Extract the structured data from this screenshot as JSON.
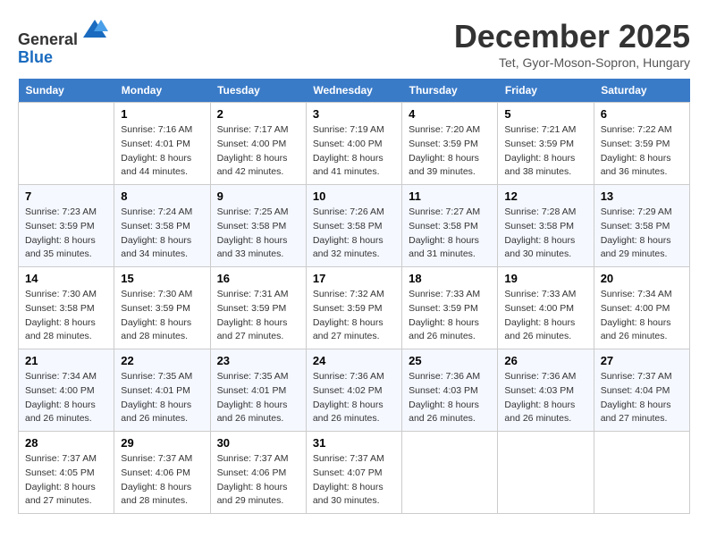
{
  "header": {
    "logo_line1": "General",
    "logo_line2": "Blue",
    "title": "December 2025",
    "location": "Tet, Gyor-Moson-Sopron, Hungary"
  },
  "days_of_week": [
    "Sunday",
    "Monday",
    "Tuesday",
    "Wednesday",
    "Thursday",
    "Friday",
    "Saturday"
  ],
  "weeks": [
    [
      {
        "num": "",
        "info": ""
      },
      {
        "num": "1",
        "info": "Sunrise: 7:16 AM\nSunset: 4:01 PM\nDaylight: 8 hours\nand 44 minutes."
      },
      {
        "num": "2",
        "info": "Sunrise: 7:17 AM\nSunset: 4:00 PM\nDaylight: 8 hours\nand 42 minutes."
      },
      {
        "num": "3",
        "info": "Sunrise: 7:19 AM\nSunset: 4:00 PM\nDaylight: 8 hours\nand 41 minutes."
      },
      {
        "num": "4",
        "info": "Sunrise: 7:20 AM\nSunset: 3:59 PM\nDaylight: 8 hours\nand 39 minutes."
      },
      {
        "num": "5",
        "info": "Sunrise: 7:21 AM\nSunset: 3:59 PM\nDaylight: 8 hours\nand 38 minutes."
      },
      {
        "num": "6",
        "info": "Sunrise: 7:22 AM\nSunset: 3:59 PM\nDaylight: 8 hours\nand 36 minutes."
      }
    ],
    [
      {
        "num": "7",
        "info": "Sunrise: 7:23 AM\nSunset: 3:59 PM\nDaylight: 8 hours\nand 35 minutes."
      },
      {
        "num": "8",
        "info": "Sunrise: 7:24 AM\nSunset: 3:58 PM\nDaylight: 8 hours\nand 34 minutes."
      },
      {
        "num": "9",
        "info": "Sunrise: 7:25 AM\nSunset: 3:58 PM\nDaylight: 8 hours\nand 33 minutes."
      },
      {
        "num": "10",
        "info": "Sunrise: 7:26 AM\nSunset: 3:58 PM\nDaylight: 8 hours\nand 32 minutes."
      },
      {
        "num": "11",
        "info": "Sunrise: 7:27 AM\nSunset: 3:58 PM\nDaylight: 8 hours\nand 31 minutes."
      },
      {
        "num": "12",
        "info": "Sunrise: 7:28 AM\nSunset: 3:58 PM\nDaylight: 8 hours\nand 30 minutes."
      },
      {
        "num": "13",
        "info": "Sunrise: 7:29 AM\nSunset: 3:58 PM\nDaylight: 8 hours\nand 29 minutes."
      }
    ],
    [
      {
        "num": "14",
        "info": "Sunrise: 7:30 AM\nSunset: 3:58 PM\nDaylight: 8 hours\nand 28 minutes."
      },
      {
        "num": "15",
        "info": "Sunrise: 7:30 AM\nSunset: 3:59 PM\nDaylight: 8 hours\nand 28 minutes."
      },
      {
        "num": "16",
        "info": "Sunrise: 7:31 AM\nSunset: 3:59 PM\nDaylight: 8 hours\nand 27 minutes."
      },
      {
        "num": "17",
        "info": "Sunrise: 7:32 AM\nSunset: 3:59 PM\nDaylight: 8 hours\nand 27 minutes."
      },
      {
        "num": "18",
        "info": "Sunrise: 7:33 AM\nSunset: 3:59 PM\nDaylight: 8 hours\nand 26 minutes."
      },
      {
        "num": "19",
        "info": "Sunrise: 7:33 AM\nSunset: 4:00 PM\nDaylight: 8 hours\nand 26 minutes."
      },
      {
        "num": "20",
        "info": "Sunrise: 7:34 AM\nSunset: 4:00 PM\nDaylight: 8 hours\nand 26 minutes."
      }
    ],
    [
      {
        "num": "21",
        "info": "Sunrise: 7:34 AM\nSunset: 4:00 PM\nDaylight: 8 hours\nand 26 minutes."
      },
      {
        "num": "22",
        "info": "Sunrise: 7:35 AM\nSunset: 4:01 PM\nDaylight: 8 hours\nand 26 minutes."
      },
      {
        "num": "23",
        "info": "Sunrise: 7:35 AM\nSunset: 4:01 PM\nDaylight: 8 hours\nand 26 minutes."
      },
      {
        "num": "24",
        "info": "Sunrise: 7:36 AM\nSunset: 4:02 PM\nDaylight: 8 hours\nand 26 minutes."
      },
      {
        "num": "25",
        "info": "Sunrise: 7:36 AM\nSunset: 4:03 PM\nDaylight: 8 hours\nand 26 minutes."
      },
      {
        "num": "26",
        "info": "Sunrise: 7:36 AM\nSunset: 4:03 PM\nDaylight: 8 hours\nand 26 minutes."
      },
      {
        "num": "27",
        "info": "Sunrise: 7:37 AM\nSunset: 4:04 PM\nDaylight: 8 hours\nand 27 minutes."
      }
    ],
    [
      {
        "num": "28",
        "info": "Sunrise: 7:37 AM\nSunset: 4:05 PM\nDaylight: 8 hours\nand 27 minutes."
      },
      {
        "num": "29",
        "info": "Sunrise: 7:37 AM\nSunset: 4:06 PM\nDaylight: 8 hours\nand 28 minutes."
      },
      {
        "num": "30",
        "info": "Sunrise: 7:37 AM\nSunset: 4:06 PM\nDaylight: 8 hours\nand 29 minutes."
      },
      {
        "num": "31",
        "info": "Sunrise: 7:37 AM\nSunset: 4:07 PM\nDaylight: 8 hours\nand 30 minutes."
      },
      {
        "num": "",
        "info": ""
      },
      {
        "num": "",
        "info": ""
      },
      {
        "num": "",
        "info": ""
      }
    ]
  ]
}
